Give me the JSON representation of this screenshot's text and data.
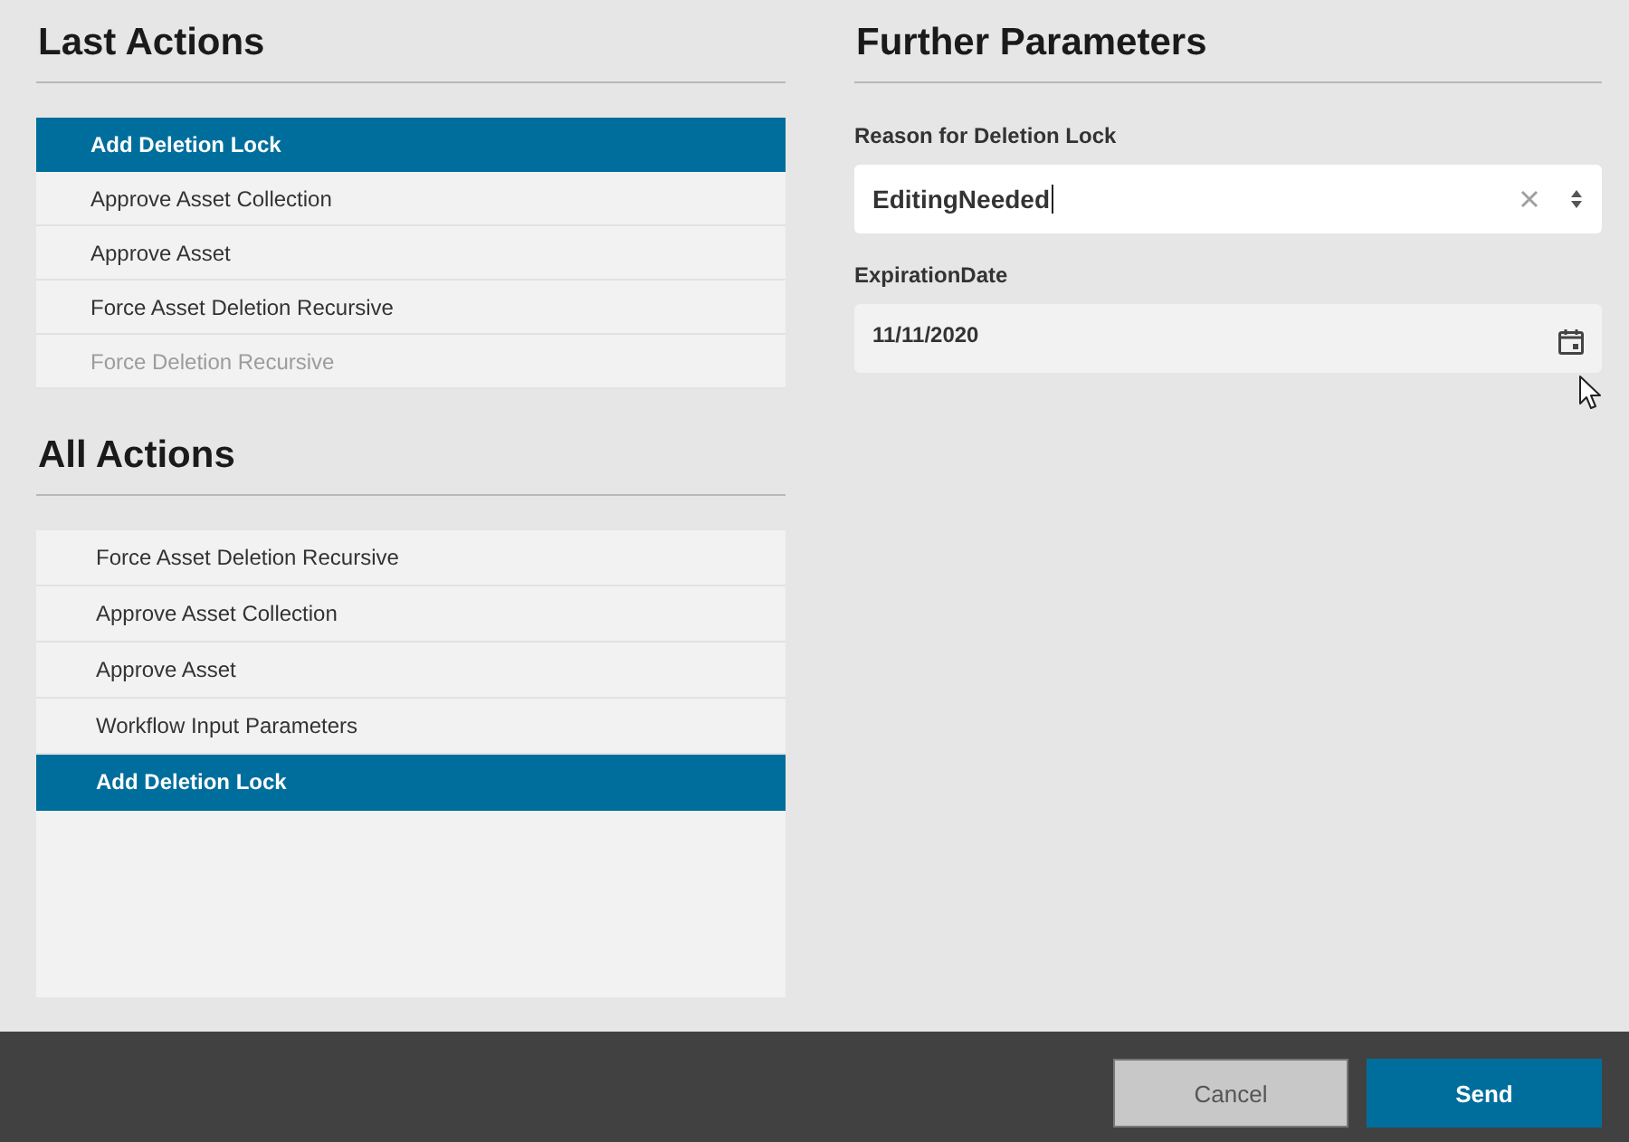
{
  "last_actions": {
    "heading": "Last Actions",
    "items": [
      {
        "label": "Add Deletion Lock",
        "selected": true,
        "disabled": false
      },
      {
        "label": "Approve Asset Collection",
        "selected": false,
        "disabled": false
      },
      {
        "label": "Approve Asset",
        "selected": false,
        "disabled": false
      },
      {
        "label": "Force Asset Deletion Recursive",
        "selected": false,
        "disabled": false
      },
      {
        "label": "Force Deletion Recursive",
        "selected": false,
        "disabled": true
      }
    ]
  },
  "all_actions": {
    "heading": "All Actions",
    "items": [
      {
        "label": "Force Asset Deletion Recursive",
        "selected": false
      },
      {
        "label": "Approve Asset Collection",
        "selected": false
      },
      {
        "label": "Approve Asset",
        "selected": false
      },
      {
        "label": "Workflow Input Parameters",
        "selected": false
      },
      {
        "label": "Add Deletion Lock",
        "selected": true
      }
    ]
  },
  "further_parameters": {
    "heading": "Further Parameters",
    "fields": [
      {
        "kind": "select",
        "label": "Reason for Deletion Lock",
        "value": "EditingNeeded",
        "focused": true
      },
      {
        "kind": "date",
        "label": "ExpirationDate",
        "value": "11/11/2020",
        "focused": false
      }
    ]
  },
  "footer": {
    "buttons": [
      {
        "label": "Cancel",
        "kind": "secondary"
      },
      {
        "label": "Send",
        "kind": "primary"
      }
    ]
  }
}
